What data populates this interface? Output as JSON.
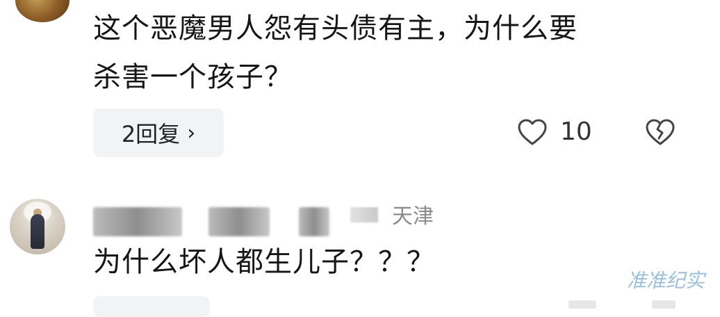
{
  "comments": [
    {
      "text_line1": "这个恶魔男人怨有头债有主，为什么要",
      "text_line2": "杀害一个孩子？",
      "replies_label": "2回复",
      "replies_chevron": "›",
      "like_icon": "heart-outline-icon",
      "like_count": "10",
      "dislike_icon": "broken-heart-icon"
    },
    {
      "location": "天津",
      "text_line1": "为什么坏人都生儿子？？？"
    }
  ],
  "watermark": "准准纪实",
  "colors": {
    "text": "#161616",
    "muted": "#8a8a8a",
    "pill_bg": "#f2f3f5",
    "watermark": "#78aad2"
  }
}
